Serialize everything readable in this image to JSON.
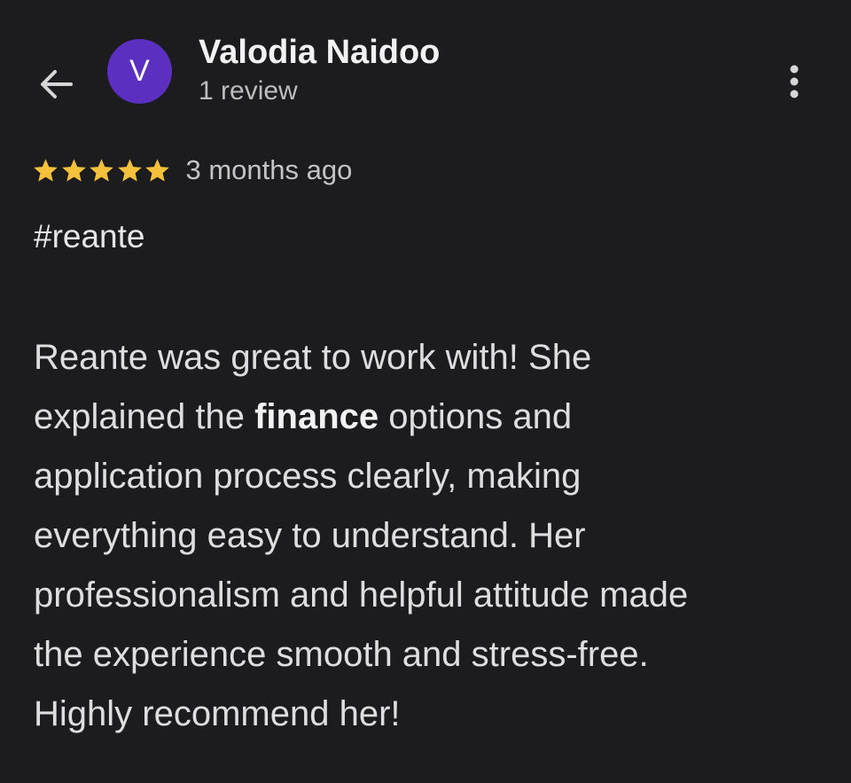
{
  "header": {
    "back_icon": "arrow-left-icon",
    "avatar_letter": "V",
    "avatar_color": "#5b2fc0",
    "reviewer_name": "Valodia Naidoo",
    "review_count": "1 review",
    "more_icon": "more-vertical-icon"
  },
  "review": {
    "rating": 5,
    "rating_max": 5,
    "star_color": "#f5c13d",
    "time_ago": "3 months ago",
    "hashtag": "#reante",
    "lines": [
      {
        "pre": "Reante was great to work with! She",
        "bold": "",
        "post": ""
      },
      {
        "pre": "explained the ",
        "bold": "finance",
        "post": " options and"
      },
      {
        "pre": "application process clearly, making",
        "bold": "",
        "post": ""
      },
      {
        "pre": "everything easy to understand. Her",
        "bold": "",
        "post": ""
      },
      {
        "pre": "professionalism and helpful attitude made",
        "bold": "",
        "post": ""
      },
      {
        "pre": "the experience smooth and stress-free.",
        "bold": "",
        "post": ""
      },
      {
        "pre": "Highly recommend her!",
        "bold": "",
        "post": ""
      }
    ]
  }
}
